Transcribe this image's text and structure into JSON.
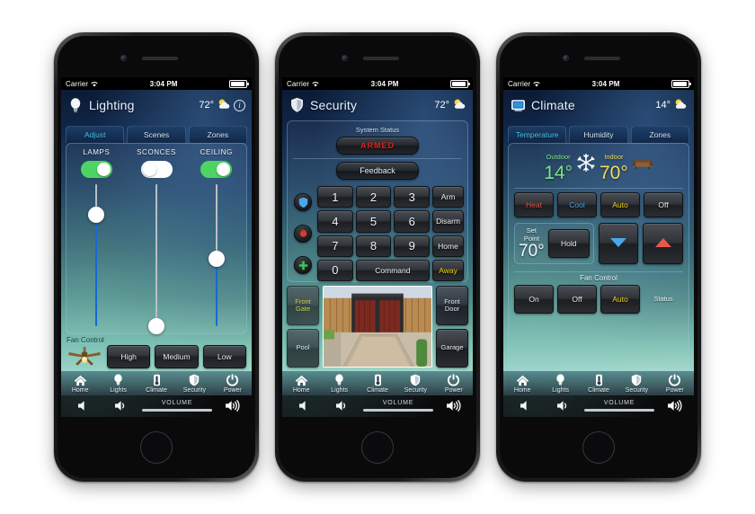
{
  "status_bar": {
    "carrier": "Carrier",
    "time": "3:04 PM",
    "wifi_icon": "wifi-icon",
    "battery_icon": "battery-icon"
  },
  "nav": {
    "items": [
      {
        "label": "Home",
        "icon": "home-icon"
      },
      {
        "label": "Lights",
        "icon": "lightbulb-icon"
      },
      {
        "label": "Climate",
        "icon": "thermometer-icon"
      },
      {
        "label": "Security",
        "icon": "shield-icon"
      },
      {
        "label": "Power",
        "icon": "power-icon"
      }
    ]
  },
  "volume": {
    "label": "VOLUME",
    "level_percent": 50,
    "mute_icon": "speaker-mute-icon",
    "down_icon": "speaker-low-icon",
    "up_icon": "speaker-high-icon"
  },
  "phones": [
    {
      "id": "lighting",
      "header": {
        "title": "Lighting",
        "icon": "lightbulb-icon",
        "temperature": "72°",
        "weather_icon": "sun-behind-cloud-icon",
        "info_icon": "info-icon",
        "info_label": "i"
      },
      "tabs": [
        {
          "label": "Adjust",
          "active": true
        },
        {
          "label": "Scenes",
          "active": false
        },
        {
          "label": "Zones",
          "active": false
        }
      ],
      "channels": [
        {
          "label": "LAMPS",
          "toggle_on": true,
          "level_percent": 75
        },
        {
          "label": "SCONCES",
          "toggle_on": false,
          "level_percent": 0
        },
        {
          "label": "CEILING",
          "toggle_on": true,
          "level_percent": 45
        }
      ],
      "fan_control": {
        "label": "Fan Control",
        "icon": "ceiling-fan-icon",
        "buttons": [
          "High",
          "Medium",
          "Low"
        ]
      }
    },
    {
      "id": "security",
      "header": {
        "title": "Security",
        "icon": "shield-icon",
        "temperature": "72°",
        "weather_icon": "sun-behind-cloud-icon"
      },
      "system_status": {
        "label": "System Status",
        "value": "ARMED",
        "value_color": "#e32020",
        "feedback_label": "Feedback"
      },
      "emergency_icons": [
        {
          "name": "police-shield-icon",
          "color": "#4aa8e8"
        },
        {
          "name": "fire-flame-icon",
          "color": "#e03a2a"
        },
        {
          "name": "medical-plus-icon",
          "color": "#3fc452"
        }
      ],
      "keypad": {
        "digits": [
          "1",
          "2",
          "3",
          "4",
          "5",
          "6",
          "7",
          "8",
          "9",
          "0"
        ],
        "command_label": "Command",
        "actions": [
          {
            "label": "Arm",
            "active": false
          },
          {
            "label": "Disarm",
            "active": false
          },
          {
            "label": "Home",
            "active": false
          },
          {
            "label": "Away",
            "active": true
          }
        ]
      },
      "cameras": {
        "left": [
          {
            "label": "Front Gate",
            "active": true
          },
          {
            "label": "Pool",
            "active": false
          }
        ],
        "right": [
          {
            "label": "Front Door",
            "active": false
          },
          {
            "label": "Garage",
            "active": false
          }
        ],
        "view_name": "camera-feed-front-gate"
      }
    },
    {
      "id": "climate",
      "header": {
        "title": "Climate",
        "icon": "thermostat-icon",
        "temperature": "14°",
        "weather_icon": "sun-behind-cloud-icon"
      },
      "tabs": [
        {
          "label": "Temperature",
          "active": true
        },
        {
          "label": "Humidity",
          "active": false
        },
        {
          "label": "Zones",
          "active": false
        }
      ],
      "readings": [
        {
          "caption": "Outdoor",
          "value": "14°",
          "icon": "snowflake-icon",
          "color": "#7de38a"
        },
        {
          "caption": "Indoor",
          "value": "70°",
          "icon": "couch-icon",
          "color": "#f3da5c"
        }
      ],
      "modes": [
        {
          "label": "Heat",
          "color": "#e8584a"
        },
        {
          "label": "Cool",
          "color": "#4aa8e8"
        },
        {
          "label": "Auto",
          "color": "#f2d41d"
        },
        {
          "label": "Off",
          "color": "#e9eef3"
        }
      ],
      "set_point": {
        "caption": "Set Point",
        "value": "70°",
        "hold_label": "Hold",
        "down_icon": "triangle-down-icon",
        "up_icon": "triangle-up-icon"
      },
      "fan_control": {
        "title": "Fan Control",
        "buttons": [
          {
            "label": "On",
            "active": false
          },
          {
            "label": "Off",
            "active": false
          },
          {
            "label": "Auto",
            "active": true
          }
        ],
        "status_label": "Status",
        "status_color": "#c62b06"
      }
    }
  ]
}
